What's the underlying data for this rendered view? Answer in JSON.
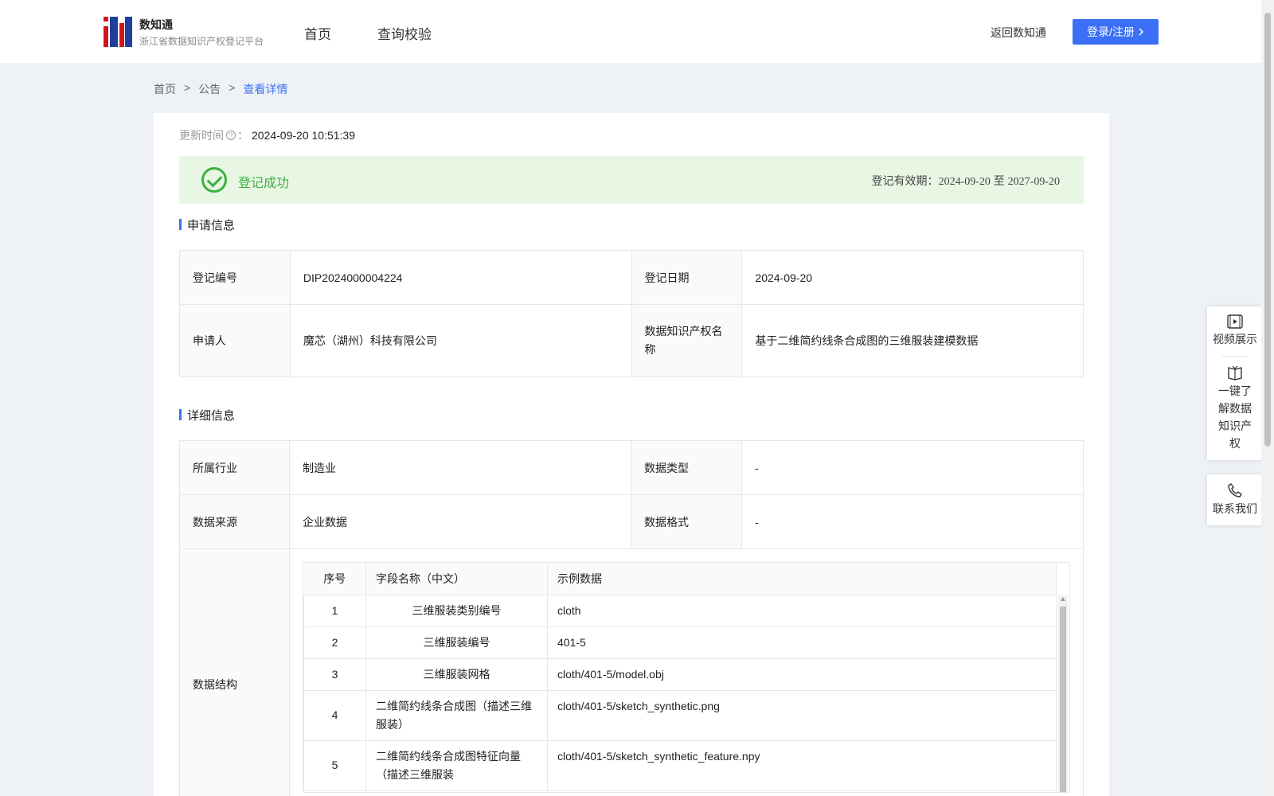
{
  "header": {
    "brand_name": "数知通",
    "brand_sub": "浙江省数据知识产权登记平台",
    "nav": [
      "首页",
      "查询校验"
    ],
    "back_link": "返回数知通",
    "login_label": "登录/注册"
  },
  "breadcrumb": [
    "首页",
    "公告",
    "查看详情"
  ],
  "update": {
    "label": "更新时间",
    "colon": "：",
    "value": "2024-09-20 10:51:39"
  },
  "status": {
    "text": "登记成功",
    "validity_label": "登记有效期：",
    "validity_start": "2024-09-20",
    "validity_sep": "至",
    "validity_end": "2027-09-20",
    "color": "#3cb043"
  },
  "apply": {
    "title": "申请信息",
    "reg_no_label": "登记编号",
    "reg_no": "DIP2024000004224",
    "reg_date_label": "登记日期",
    "reg_date": "2024-09-20",
    "applicant_label": "申请人",
    "applicant": "魔芯（湖州）科技有限公司",
    "ip_name_label": "数据知识产权名称",
    "ip_name": "基于二维简约线条合成图的三维服装建模数据"
  },
  "detail": {
    "title": "详细信息",
    "industry_label": "所属行业",
    "industry": "制造业",
    "type_label": "数据类型",
    "type": "-",
    "source_label": "数据来源",
    "source": "企业数据",
    "format_label": "数据格式",
    "format": "-",
    "structure_label": "数据结构",
    "structure_headers": [
      "序号",
      "字段名称（中文）",
      "示例数据"
    ],
    "structure_rows": [
      {
        "no": "1",
        "name": "三维服装类别编号",
        "example": "cloth"
      },
      {
        "no": "2",
        "name": "三维服装编号",
        "example": "401-5"
      },
      {
        "no": "3",
        "name": "三维服装网格",
        "example": "cloth/401-5/model.obj"
      },
      {
        "no": "4",
        "name": "二维简约线条合成图（描述三维服装）",
        "example": "cloth/401-5/sketch_synthetic.png"
      },
      {
        "no": "5",
        "name": "二维简约线条合成图特征向量（描述三维服装",
        "example": "cloth/401-5/sketch_synthetic_feature.npy"
      }
    ]
  },
  "float_menu": {
    "video": "视频展示",
    "learn": "一键了解数据知识产权",
    "contact": "联系我们"
  },
  "colors": {
    "accent": "#3b6ff5",
    "success_bg": "#e8f7e4",
    "logo_red": "#d0141e",
    "logo_blue": "#1f3f9e"
  }
}
